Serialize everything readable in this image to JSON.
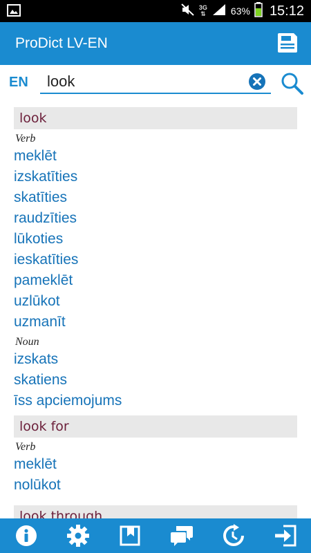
{
  "status_bar": {
    "network": "3G",
    "battery": "63%",
    "time": "15:12"
  },
  "app": {
    "title": "ProDict LV-EN"
  },
  "search": {
    "language": "EN",
    "query": "look"
  },
  "results": [
    {
      "headword": "look",
      "groups": [
        {
          "pos": "Verb",
          "translations": [
            "meklēt",
            "izskatīties",
            "skatīties",
            "raudzīties",
            "lūkoties",
            "ieskatīties",
            "pameklēt",
            "uzlūkot",
            "uzmanīt"
          ]
        },
        {
          "pos": "Noun",
          "translations": [
            "izskats",
            "skatiens",
            "īss apciemojums"
          ]
        }
      ]
    },
    {
      "headword": "look for",
      "groups": [
        {
          "pos": "Verb",
          "translations": [
            "meklēt",
            "nolūkot"
          ]
        }
      ]
    },
    {
      "headword": "look through",
      "groups": []
    }
  ],
  "colors": {
    "accent": "#1a8bd0",
    "headword": "#6b1f3a",
    "translation": "#1673b8"
  }
}
